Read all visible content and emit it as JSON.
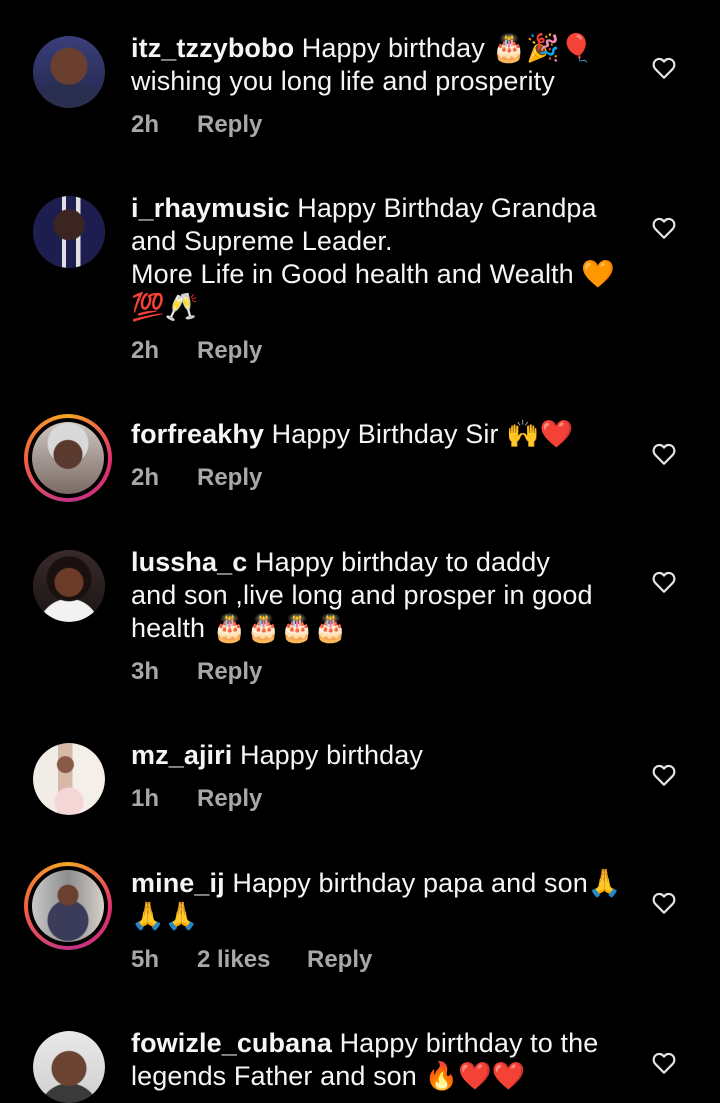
{
  "labels": {
    "reply": "Reply"
  },
  "comments": [
    {
      "username": "itz_tzzybobo",
      "text_lines": [
        "Happy birthday 🎂🎉🎈",
        "wishing you long life and prosperity"
      ],
      "time": "2h",
      "likes": ""
    },
    {
      "username": "i_rhaymusic",
      "text_lines": [
        "Happy Birthday Grandpa",
        "and Supreme Leader.",
        "More Life in Good health and Wealth 🧡",
        "💯🥂"
      ],
      "time": "2h",
      "likes": ""
    },
    {
      "username": "forfreakhy",
      "text_lines": [
        "Happy Birthday Sir 🙌❤️"
      ],
      "time": "2h",
      "likes": ""
    },
    {
      "username": "lussha_c",
      "text_lines": [
        "Happy birthday to daddy",
        "and son ,live long and prosper in good",
        "health 🎂🎂🎂🎂"
      ],
      "time": "3h",
      "likes": ""
    },
    {
      "username": "mz_ajiri",
      "text_lines": [
        "Happy birthday"
      ],
      "time": "1h",
      "likes": ""
    },
    {
      "username": "mine_ij",
      "text_lines": [
        "Happy birthday papa and son🙏",
        "🙏🙏"
      ],
      "time": "5h",
      "likes": "2 likes"
    },
    {
      "username": "fowizle_cubana",
      "text_lines": [
        "Happy birthday to the",
        "legends Father and son 🔥❤️❤️"
      ],
      "time": "",
      "likes": ""
    }
  ],
  "icons": {
    "like": "heart-outline-icon"
  },
  "colors": {
    "background": "#000000",
    "text": "#f5f5f5",
    "meta": "#a8a8a8",
    "story_ring": "#e1306c"
  }
}
